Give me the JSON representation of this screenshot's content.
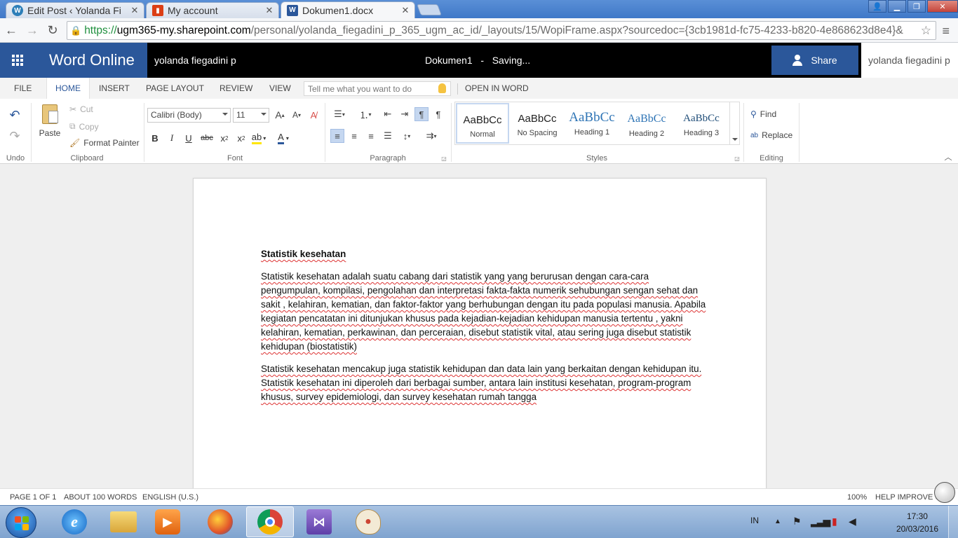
{
  "browser": {
    "tabs": [
      {
        "title": "Edit Post ‹ Yolanda Fi",
        "icon": "wordpress-icon"
      },
      {
        "title": "My account",
        "icon": "office-icon"
      },
      {
        "title": "Dokumen1.docx",
        "icon": "word-icon"
      }
    ],
    "active_tab": 2,
    "url": {
      "scheme": "https://",
      "host": "ugm365-my.sharepoint.com",
      "path": "/personal/yolanda_fiegadini_p_365_ugm_ac_id/_layouts/15/WopiFrame.aspx?sourcedoc={3cb1981d-fc75-4233-b820-4e868623d8e4}&"
    }
  },
  "app": {
    "name": "Word Online",
    "owner": "yolanda fiegadini p",
    "document_title": "Dokumen1   -   Saving...",
    "share_label": "Share",
    "user_name": "yolanda fiegadini p",
    "brand_color": "#2b579a"
  },
  "ribbon": {
    "tabs": [
      "FILE",
      "HOME",
      "INSERT",
      "PAGE LAYOUT",
      "REVIEW",
      "VIEW"
    ],
    "active_tab": "HOME",
    "tell_me_placeholder": "Tell me what you want to do",
    "open_in_word": "OPEN IN WORD",
    "clipboard": {
      "paste": "Paste",
      "cut": "Cut",
      "copy": "Copy",
      "format_painter": "Format Painter"
    },
    "font": {
      "family": "Calibri (Body)",
      "size": "11"
    },
    "styles": [
      {
        "preview": "AaBbCc",
        "name": "Normal",
        "selected": true
      },
      {
        "preview": "AaBbCc",
        "name": "No Spacing",
        "selected": false
      },
      {
        "preview": "AaBbCc",
        "name": "Heading 1",
        "selected": false
      },
      {
        "preview": "AaBbCc",
        "name": "Heading 2",
        "selected": false
      },
      {
        "preview": "AaBbCc",
        "name": "Heading 3",
        "selected": false
      }
    ],
    "editing": {
      "find": "Find",
      "replace": "Replace"
    },
    "group_labels": {
      "undo": "Undo",
      "clipboard": "Clipboard",
      "font": "Font",
      "paragraph": "Paragraph",
      "styles": "Styles",
      "editing": "Editing"
    }
  },
  "document": {
    "heading": "Statistik kesehatan",
    "paragraphs": [
      "Statistik kesehatan adalah suatu cabang dari statistik yang yang berurusan dengan cara-cara pengumpulan, kompilasi, pengolahan dan interpretasi fakta-fakta numerik sehubungan sengan sehat dan sakit , kelahiran, kematian, dan faktor-faktor yang berhubungan dengan itu pada populasi manusia. Apabila kegiatan pencatatan ini ditunjukan khusus pada kejadian-kejadian kehidupan manusia tertentu , yakni kelahiran, kematian, perkawinan, dan perceraian, disebut statistik vital, atau sering juga disebut statistik kehidupan (biostatistik)",
      "Statistik kesehatan mencakup juga statistik kehidupan dan data lain yang berkaitan dengan kehidupan itu. Statistik kesehatan ini diperoleh dari berbagai sumber, antara lain institusi kesehatan, program-program khusus, survey epidemiologi, dan survey kesehatan rumah tangga"
    ]
  },
  "status_bar": {
    "page": "PAGE 1 OF 1",
    "words": "ABOUT 100 WORDS",
    "language": "ENGLISH (U.S.)",
    "zoom": "100%",
    "help": "HELP IMPROVE O"
  },
  "taskbar": {
    "input_language": "IN",
    "time": "17:30",
    "date": "20/03/2016",
    "apps": [
      "internet-explorer-icon",
      "file-explorer-icon",
      "media-player-icon",
      "firefox-icon",
      "chrome-icon",
      "visual-studio-icon",
      "paint-icon"
    ],
    "active_app": "chrome-icon"
  }
}
